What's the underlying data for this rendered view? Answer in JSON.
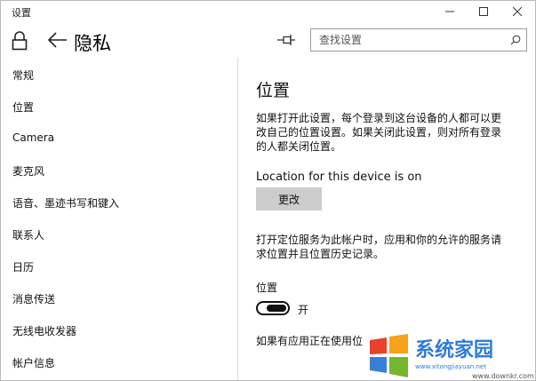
{
  "window": {
    "title": "设置"
  },
  "header": {
    "title": "隐私",
    "search": {
      "placeholder": "查找设置",
      "value": ""
    }
  },
  "nav": {
    "items": [
      {
        "label": "常规"
      },
      {
        "label": "位置"
      },
      {
        "label": "Camera"
      },
      {
        "label": "麦克风"
      },
      {
        "label": "语音、墨迹书写和键入"
      },
      {
        "label": "联系人"
      },
      {
        "label": "日历"
      },
      {
        "label": "消息传送"
      },
      {
        "label": "无线电收发器"
      },
      {
        "label": "帐户信息"
      }
    ]
  },
  "content": {
    "title": "位置",
    "paragraph1_line1": "如果打开此设置，每个登录到这台设备的人都可以更",
    "paragraph1_line2": "改自己的位置设置。如果关闭此设置，则对所有登录",
    "paragraph1_line3": "的人都关闭位置。",
    "device_status": "Location for this device is on",
    "change_button": "更改",
    "paragraph2_line1": "打开定位服务为此帐户时，应用和你的允许的服务请",
    "paragraph2_line2": "求位置并且位置历史记录。",
    "toggle_label": "位置",
    "toggle_state": "开",
    "toggle_on": true,
    "paragraph3": "如果有应用正在使用位"
  },
  "watermark": {
    "text": "系统家园",
    "url": "www.xitongjiayuan.net",
    "subtext": "www.downkr.com"
  },
  "colors": {
    "button_bg": "#cccccc",
    "border": "#9a9a9a",
    "text": "#111111"
  }
}
